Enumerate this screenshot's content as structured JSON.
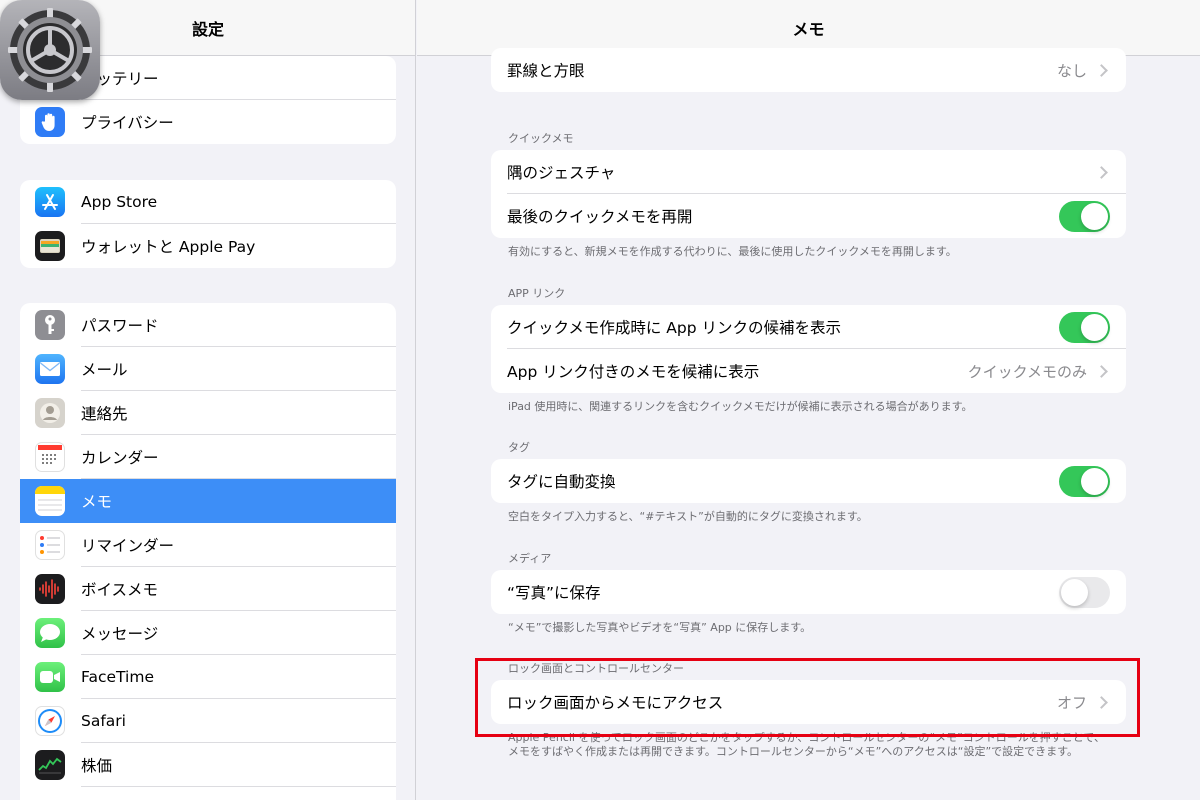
{
  "sidebar": {
    "title": "設定",
    "groups": [
      {
        "items": [
          {
            "label": "バッテリー",
            "icon": "battery-icon"
          },
          {
            "label": "プライバシー",
            "icon": "privacy-hand-icon"
          }
        ]
      },
      {
        "items": [
          {
            "label": "App Store",
            "icon": "app-store-icon"
          },
          {
            "label": "ウォレットと Apple Pay",
            "icon": "wallet-icon"
          }
        ]
      },
      {
        "items": [
          {
            "label": "パスワード",
            "icon": "key-icon"
          },
          {
            "label": "メール",
            "icon": "mail-icon"
          },
          {
            "label": "連絡先",
            "icon": "contacts-icon"
          },
          {
            "label": "カレンダー",
            "icon": "calendar-icon"
          },
          {
            "label": "メモ",
            "icon": "notes-icon",
            "selected": true
          },
          {
            "label": "リマインダー",
            "icon": "reminders-icon"
          },
          {
            "label": "ボイスメモ",
            "icon": "voice-memos-icon"
          },
          {
            "label": "メッセージ",
            "icon": "messages-icon"
          },
          {
            "label": "FaceTime",
            "icon": "facetime-icon"
          },
          {
            "label": "Safari",
            "icon": "safari-icon"
          },
          {
            "label": "株価",
            "icon": "stocks-icon"
          }
        ]
      }
    ]
  },
  "detail": {
    "title": "メモ",
    "lines": {
      "label": "罫線と方眼",
      "value": "なし"
    },
    "quicknote": {
      "header": "クイックメモ",
      "corner_gesture": "隅のジェスチャ",
      "resume_last": "最後のクイックメモを再開",
      "resume_last_on": true,
      "footer": "有効にすると、新規メモを作成する代わりに、最後に使用したクイックメモを再開します。"
    },
    "applinks": {
      "header": "APP リンク",
      "suggest_when_creating": "クイックメモ作成時に App リンクの候補を表示",
      "suggest_when_creating_on": true,
      "show_linked_notes": "App リンク付きのメモを候補に表示",
      "show_linked_notes_value": "クイックメモのみ",
      "footer": "iPad 使用時に、関連するリンクを含むクイックメモだけが候補に表示される場合があります。"
    },
    "tags": {
      "header": "タグ",
      "auto_convert": "タグに自動変換",
      "auto_convert_on": true,
      "footer": "空白をタイプ入力すると、“#テキスト”が自動的にタグに変換されます。"
    },
    "media": {
      "header": "メディア",
      "save_to_photos": "“写真”に保存",
      "save_to_photos_on": false,
      "footer": "“メモ”で撮影した写真やビデオを“写真” App に保存します。"
    },
    "lockscreen": {
      "header": "ロック画面とコントロールセンター",
      "access": "ロック画面からメモにアクセス",
      "access_value": "オフ",
      "footer": "Apple Pencil を使ってロック画面のどこかをタップするか、コントロールセンターの“メモ”コントロールを押すことで、メモをすばやく作成または再開できます。コントロールセンターから“メモ”へのアクセスは“設定”で設定できます。"
    }
  },
  "colors": {
    "selection": "#3d8ef7",
    "toggle_on": "#34c759",
    "highlight": "#e60012"
  }
}
